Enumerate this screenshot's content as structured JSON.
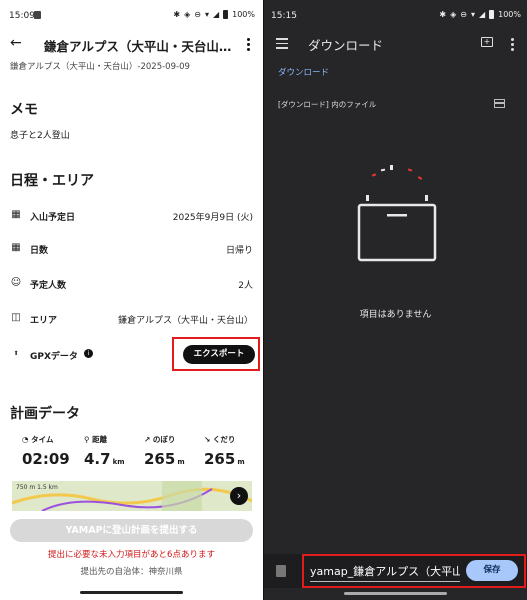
{
  "left": {
    "status": {
      "time": "15:09",
      "battery": "100%"
    },
    "appbar": {
      "title": "鎌倉アルプス（大平山・天台山…"
    },
    "subtitle": "鎌倉アルプス（大平山・天台山）-2025-09-09",
    "memo": {
      "heading": "メモ",
      "text": "息子と2人登山"
    },
    "schedule": {
      "heading": "日程・エリア",
      "rows": [
        {
          "label": "入山予定日",
          "value": "2025年9月9日 (火)",
          "icon": "calendar-icon"
        },
        {
          "label": "日数",
          "value": "日帰り",
          "icon": "calendar-icon"
        },
        {
          "label": "予定人数",
          "value": "2人",
          "icon": "people-icon"
        },
        {
          "label": "エリア",
          "value": "鎌倉アルプス（大平山・天台山）",
          "icon": "map-icon"
        }
      ],
      "gpx_label": "GPXデータ",
      "export_label": "エクスポート"
    },
    "plan": {
      "heading": "計画データ",
      "stats": [
        {
          "label": "タイム",
          "value": "02:09",
          "unit": ""
        },
        {
          "label": "距離",
          "value": "4.7",
          "unit": "km"
        },
        {
          "label": "のぼり",
          "value": "265",
          "unit": "m"
        },
        {
          "label": "くだり",
          "value": "265",
          "unit": "m"
        }
      ],
      "map_scale": "750 m     1.5 km"
    },
    "submit_label": "YAMAPに登山計画を提出する",
    "warning": "提出に必要な未入力項目があと6点あります",
    "destination": "提出先の自治体：神奈川県"
  },
  "right": {
    "status": {
      "time": "15:15",
      "battery": "100%"
    },
    "appbar": {
      "title": "ダウンロード"
    },
    "breadcrumb": "ダウンロード",
    "files_in": "[ダウンロード] 内のファイル",
    "empty_text": "項目はありません",
    "filename": "yamap_鎌倉アルプス（大平山",
    "save_label": "保存"
  },
  "colors": {
    "highlight": "#e21b1b",
    "accent_blue": "#a8c7fa",
    "warning": "#d21a1a"
  }
}
